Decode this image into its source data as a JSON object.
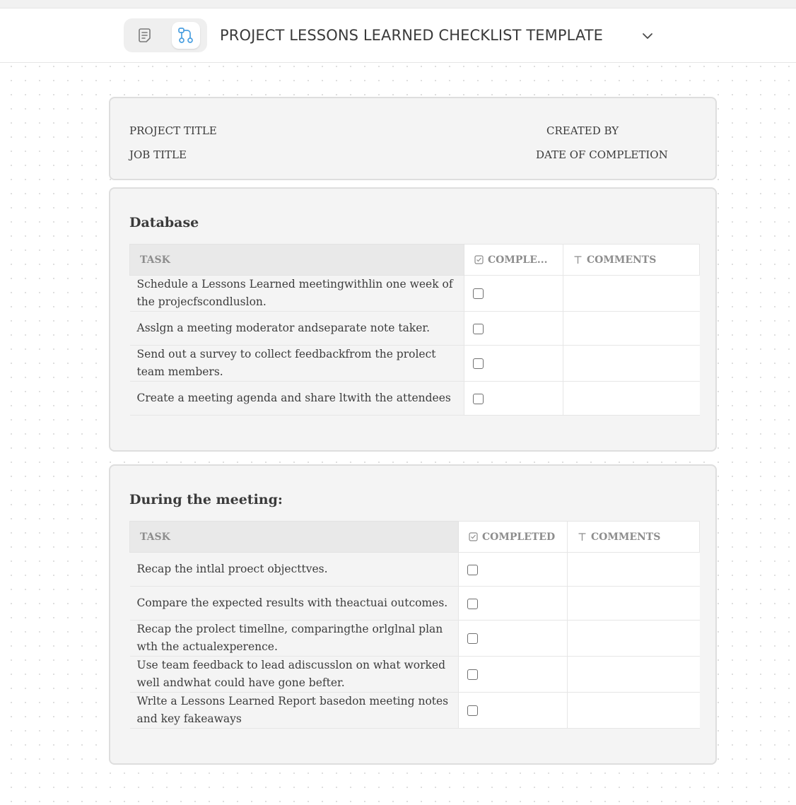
{
  "header": {
    "title": "PROJECT LESSONS LEARNED CHECKLIST TEMPLATE",
    "views": [
      "doc-view-icon",
      "whiteboard-view-icon"
    ],
    "accent": "#4a9fe0"
  },
  "meta": {
    "project_title": "PROJECT TITLE",
    "job_title": "JOB TITLE",
    "created_by": "CREATED BY",
    "date_of_completion": "DATE OF COMPLETION"
  },
  "database": {
    "title": "Database",
    "columns": {
      "task": "TASK",
      "completed": "COMPLE...",
      "comments": "COMMENTS"
    },
    "rows": [
      {
        "task": "Schedule a Lessons Learned meetingwithlin one week of the projecfscondluslon.",
        "completed": false,
        "comments": ""
      },
      {
        "task": "Asslgn a meeting moderator andseparate note taker.",
        "completed": false,
        "comments": ""
      },
      {
        "task": "Send out a survey to collect feedbackfrom the prolect team members.",
        "completed": false,
        "comments": ""
      },
      {
        "task": "Create a meeting agenda and share ltwith the attendees",
        "completed": false,
        "comments": ""
      }
    ]
  },
  "meeting": {
    "title": "During the meeting:",
    "columns": {
      "task": "TASK",
      "completed": "COMPLETED",
      "comments": "COMMENTS"
    },
    "rows": [
      {
        "task": "Recap the intlal proect objecttves.",
        "completed": false,
        "comments": ""
      },
      {
        "task": "Compare the expected results with theactuai outcomes.",
        "completed": false,
        "comments": ""
      },
      {
        "task": "Recap the prolect timellne, comparingthe orlglnal plan wth the actualexperence.",
        "completed": false,
        "comments": ""
      },
      {
        "task": "Use team feedback to lead adiscusslon on what worked well andwhat could have gone befter.",
        "completed": false,
        "comments": ""
      },
      {
        "task": "Wrlte a Lessons Learned Report basedon meeting notes and key fakeaways",
        "completed": false,
        "comments": ""
      }
    ]
  }
}
